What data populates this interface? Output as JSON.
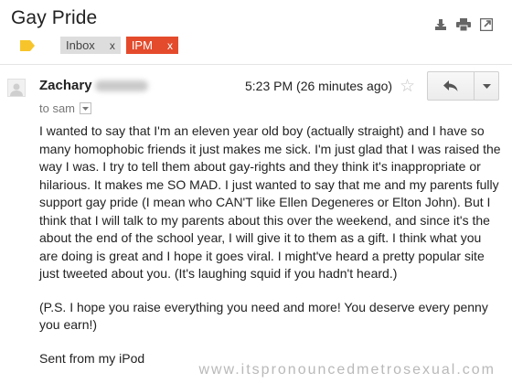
{
  "header": {
    "subject": "Gay Pride",
    "icons": [
      "download-icon",
      "print-icon",
      "open-in-new-window-icon"
    ]
  },
  "labels": [
    {
      "name": "Inbox",
      "remove": "x",
      "color": "#dddddd"
    },
    {
      "name": "IPM",
      "remove": "x",
      "color": "#e44b2c"
    }
  ],
  "message": {
    "sender": "Zachary",
    "timestamp": "5:23 PM (26 minutes ago)",
    "to": "to sam",
    "body": [
      "I wanted to say that I'm an eleven year old boy (actually straight) and I have so many homophobic friends it just makes me sick. I'm just glad that I was raised the way I was. I try to tell them about gay-rights and they think it's inappropriate or hilarious. It makes me SO MAD. I just wanted to say that me and my parents fully support gay pride (I mean who CAN'T like Ellen Degeneres or Elton John). But I think that I will talk to my parents about this over the weekend, and since it's the about the end of the school year, I will give it to them as a gift. I think what you are doing is great and I hope it goes viral. I might've heard a pretty popular site just tweeted about you. (It's laughing squid if you hadn't heard.)",
      "(P.S. I hope you raise everything you need and more! You deserve every penny you earn!)",
      "Sent from my iPod"
    ]
  },
  "watermark": "www.itspronouncedmetrosexual.com",
  "colors": {
    "accent_label": "#e44b2c",
    "important_marker": "#f7c52b"
  }
}
